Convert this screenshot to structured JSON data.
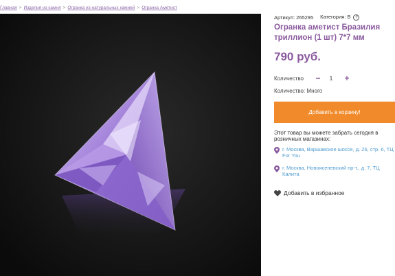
{
  "breadcrumb": {
    "items": [
      "Главная",
      "Изделия из камня",
      "Огранка из натуральных камней",
      "Огранка Аметист"
    ],
    "separator": ">"
  },
  "product": {
    "sku_label": "Артикул: 265295",
    "category_label": "Категория: B",
    "help_icon": "?",
    "title": "Огранка аметист Бразилия триллион (1 шт) 7*7 мм",
    "price": "790 руб.",
    "quantity_label": "Количество",
    "quantity_value": "1",
    "minus_label": "−",
    "plus_label": "+",
    "stock": "Количество: Много",
    "add_to_cart": "Добавить в корзину!",
    "pickup_note": "Этот товар вы можете забрать сегодня в розничных магазинах:",
    "stores": [
      "г. Москва, Варшавское шоссе, д. 26, стр. 6, ТЦ For You",
      "г. Москва, Новоясеневский пр-т., д. 7, ТЦ Калита"
    ],
    "favorite": "Добавить в избранное"
  },
  "colors": {
    "accent": "#8a5a9e",
    "button": "#f08a2a",
    "link": "#4e9bd0",
    "photo_bg": "#121212",
    "gem": "#9b78d6"
  }
}
